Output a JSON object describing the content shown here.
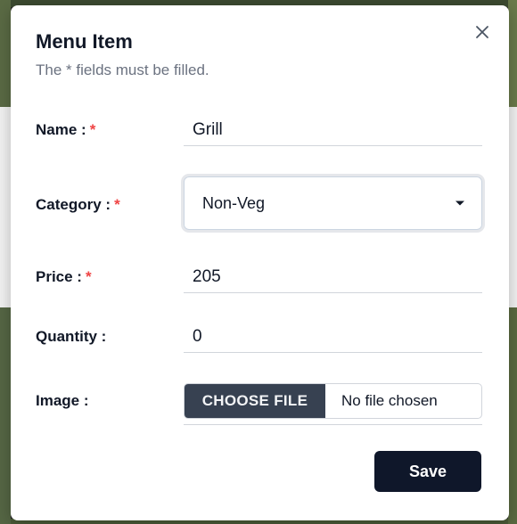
{
  "modal": {
    "title": "Menu Item",
    "subtitle": "The * fields must be filled.",
    "close_icon": "close-icon",
    "save_label": "Save"
  },
  "fields": {
    "name": {
      "label": "Name :",
      "required": "*",
      "value": "Grill"
    },
    "category": {
      "label": "Category :",
      "required": "*",
      "value": "Non-Veg",
      "icon": "caret-down-icon"
    },
    "price": {
      "label": "Price :",
      "required": "*",
      "value": "205"
    },
    "quantity": {
      "label": "Quantity :",
      "value": "0"
    },
    "image": {
      "label": "Image :",
      "button_label": "CHOOSE FILE",
      "file_status": "No file chosen"
    }
  },
  "colors": {
    "primary": "#0f172a",
    "required": "#ef4444",
    "file_button": "#374151"
  }
}
